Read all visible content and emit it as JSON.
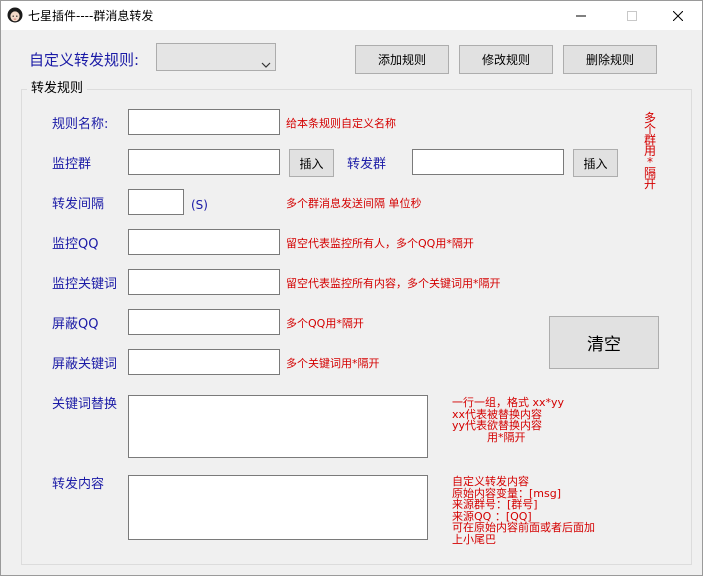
{
  "window": {
    "title": "七星插件----群消息转发"
  },
  "rule_select": {
    "label": "自定义转发规则:",
    "value": ""
  },
  "toolbar": {
    "add_label": "添加规则",
    "edit_label": "修改规则",
    "delete_label": "删除规则"
  },
  "group": {
    "title": "转发规则"
  },
  "fields": {
    "rule_name": {
      "label": "规则名称:",
      "value": "",
      "hint": "给本条规则自定义名称"
    },
    "monitor_group": {
      "label": "监控群",
      "value": "",
      "insert_label": "插入"
    },
    "forward_group": {
      "label": "转发群",
      "value": "",
      "insert_label": "插入"
    },
    "interval": {
      "label": "转发间隔",
      "value": "",
      "unit": "(S)",
      "hint": "多个群消息发送间隔 单位秒"
    },
    "monitor_qq": {
      "label": "监控QQ",
      "value": "",
      "hint": "留空代表监控所有人，多个QQ用*隔开"
    },
    "monitor_keywords": {
      "label": "监控关键词",
      "value": "",
      "hint": "留空代表监控所有内容，多个关键词用*隔开"
    },
    "block_qq": {
      "label": "屏蔽QQ",
      "value": "",
      "hint": "多个QQ用*隔开"
    },
    "block_keywords": {
      "label": "屏蔽关键词",
      "value": "",
      "hint": "多个关键词用*隔开"
    },
    "keyword_replace": {
      "label": "关键词替换",
      "value": "",
      "hint_lines": [
        "一行一组，格式 xx*yy",
        "xx代表被替换内容",
        "yy代表欲替换内容",
        "          用*隔开"
      ]
    },
    "forward_content": {
      "label": "转发内容",
      "value": "",
      "hint_lines": [
        "自定义转发内容",
        "原始内容变量：[msg]",
        "来源群号：[群号]",
        "来源QQ ：[QQ]",
        "可在原始内容前面或者后面加",
        "上小尾巴"
      ]
    }
  },
  "clear_button": {
    "label": "清空"
  },
  "side_hint": {
    "chars": [
      "多",
      "个",
      "群",
      "用",
      "*",
      "隔",
      "开"
    ]
  },
  "colors": {
    "label_blue": "#1a1aa6",
    "hint_red": "#d40000",
    "window_bg": "#f0f0f0"
  },
  "icons": {
    "app": "avatar-icon",
    "minimize": "minimize-icon",
    "maximize": "maximize-icon",
    "close": "close-icon",
    "dropdown": "chevron-down-icon"
  }
}
